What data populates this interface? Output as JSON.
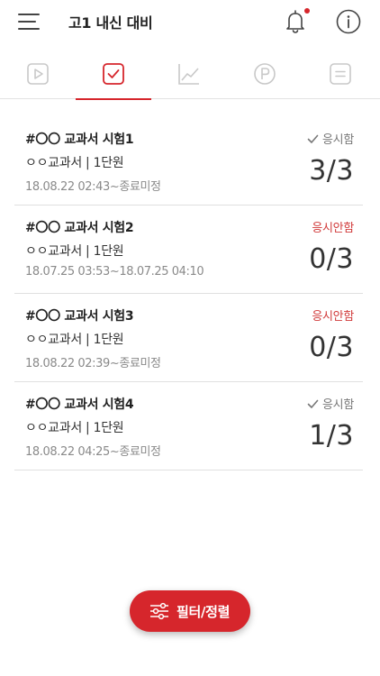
{
  "header": {
    "title": "고1 내신 대비",
    "has_notification": true
  },
  "tabs": [
    {
      "icon": "play-icon",
      "active": false
    },
    {
      "icon": "checkbox-icon",
      "active": true
    },
    {
      "icon": "chart-icon",
      "active": false
    },
    {
      "icon": "p-circle-icon",
      "active": false
    },
    {
      "icon": "list-icon",
      "active": false
    }
  ],
  "items": [
    {
      "title": "#〇〇 교과서 시험1",
      "subtitle": "ㅇㅇ교과서 | 1단원",
      "date": "18.08.22 02:43~종료미정",
      "status": "응시함",
      "score": "3/3"
    },
    {
      "title": "#〇〇 교과서 시험2",
      "subtitle": "ㅇㅇ교과서 | 1단원",
      "date": "18.07.25 03:53~18.07.25 04:10",
      "status": "응시안함",
      "score": "0/3"
    },
    {
      "title": "#〇〇 교과서 시험3",
      "subtitle": "ㅇㅇ교과서 | 1단원",
      "date": "18.08.22 02:39~종료미정",
      "status": "응시안함",
      "score": "0/3"
    },
    {
      "title": "#〇〇 교과서 시험4",
      "subtitle": "ㅇㅇ교과서 | 1단원",
      "date": "18.08.22 04:25~종료미정",
      "status": "응시함",
      "score": "1/3"
    }
  ],
  "fab": {
    "label": "필터/정렬"
  },
  "colors": {
    "accent": "#d6262c",
    "status_done": "#777777",
    "status_missed": "#d13a3a"
  }
}
